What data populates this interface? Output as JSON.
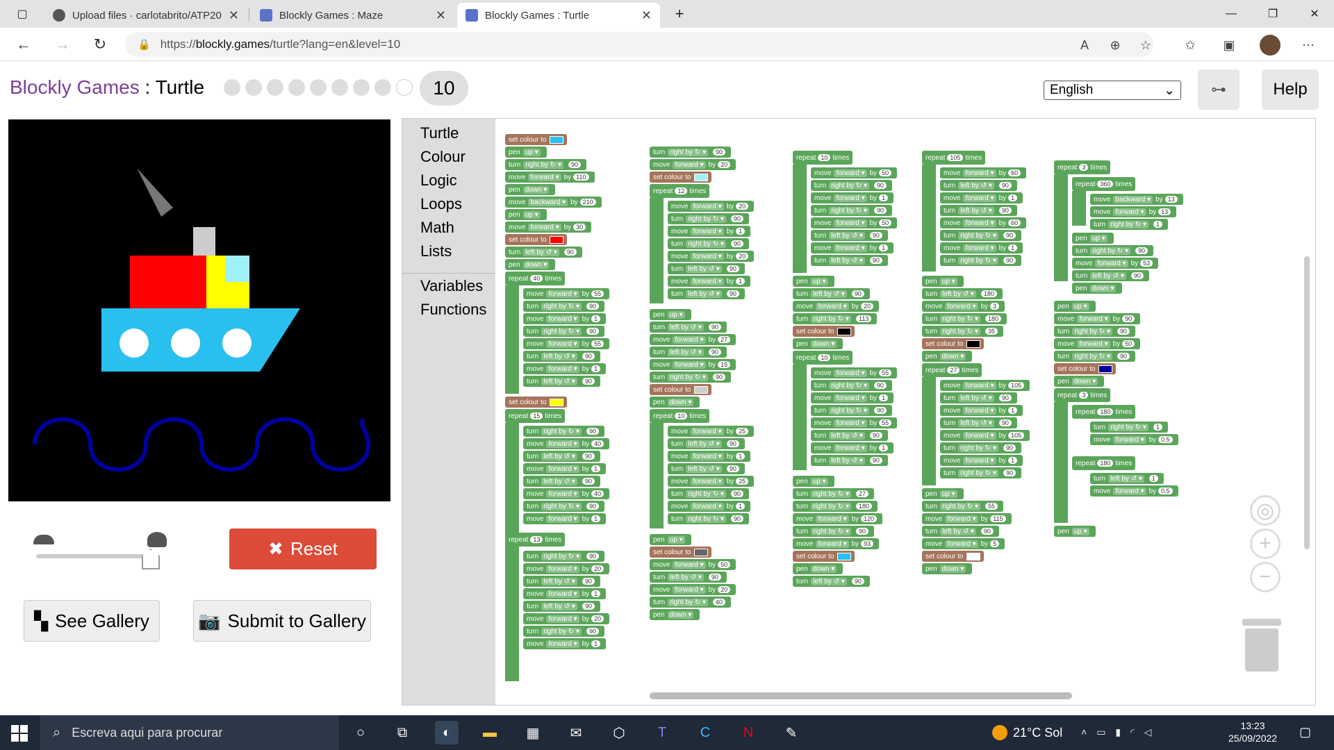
{
  "browser": {
    "tabs": [
      {
        "title": "Upload files · carlotabrito/ATP20",
        "active": false,
        "favicon": "github-icon"
      },
      {
        "title": "Blockly Games : Maze",
        "active": false,
        "favicon": "blockly-icon"
      },
      {
        "title": "Blockly Games : Turtle",
        "active": true,
        "favicon": "blockly-icon"
      }
    ],
    "url_prefix": "https://",
    "url_host": "blockly.games",
    "url_path": "/turtle?lang=en&level=10"
  },
  "header": {
    "brand": "Blockly Games",
    "separator": " : ",
    "game": "Turtle",
    "current_level": "10",
    "language": "English",
    "help_label": "Help"
  },
  "controls": {
    "reset_label": "Reset",
    "gallery_label": "See Gallery",
    "submit_label": "Submit to Gallery",
    "speed_fraction": 0.9
  },
  "toolbox": [
    "Turtle",
    "Colour",
    "Logic",
    "Loops",
    "Math",
    "Lists",
    "Variables",
    "Functions"
  ],
  "colors": {
    "brand": "#7d3f98",
    "reset": "#dd4b39",
    "turtle_block": "#5ba55b",
    "colour_block": "#a5745b",
    "boat_hull": "#29c0f0",
    "boat_red": "#ff0000",
    "boat_yellow": "#ffff00",
    "waves": "#0000a0"
  },
  "taskbar": {
    "search_placeholder": "Escreva aqui para procurar",
    "weather": "21°C  Sol",
    "time": "13:23",
    "date": "25/09/2022"
  }
}
